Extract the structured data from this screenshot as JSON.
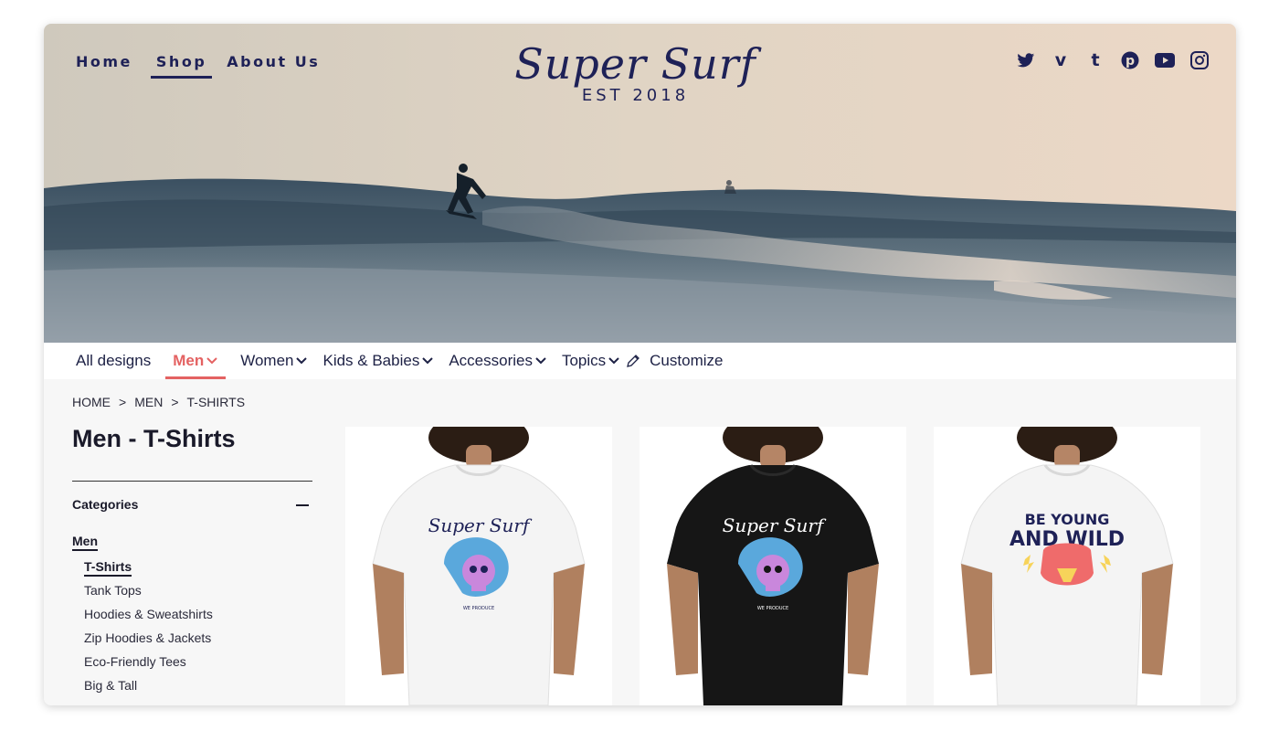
{
  "header": {
    "nav": [
      {
        "label": "Home",
        "active": false
      },
      {
        "label": "Shop",
        "active": true
      },
      {
        "label": "About Us",
        "active": false
      }
    ],
    "logo": {
      "name": "Super Surf",
      "tagline": "EST 2018"
    },
    "social_icons": [
      "twitter-icon",
      "vimeo-icon",
      "tumblr-icon",
      "pinterest-icon",
      "youtube-icon",
      "instagram-icon"
    ],
    "brand_color": "#1e2157"
  },
  "category_nav": {
    "items": [
      {
        "label": "All designs",
        "dropdown": false,
        "active": false
      },
      {
        "label": "Men",
        "dropdown": true,
        "active": true
      },
      {
        "label": "Women",
        "dropdown": true,
        "active": false
      },
      {
        "label": "Kids & Babies",
        "dropdown": true,
        "active": false
      },
      {
        "label": "Accessories",
        "dropdown": true,
        "active": false
      },
      {
        "label": "Topics",
        "dropdown": true,
        "active": false
      }
    ],
    "customize": {
      "label": "Customize",
      "icon": "pencil-icon"
    },
    "accent_color": "#e46262"
  },
  "breadcrumb": [
    "HOME",
    ">",
    "MEN",
    ">",
    "T-SHIRTS"
  ],
  "page_title": "Men - T-Shirts",
  "sidebar": {
    "heading": "Categories",
    "parent": "Men",
    "items": [
      {
        "label": "T-Shirts",
        "active": true
      },
      {
        "label": "Tank Tops",
        "active": false
      },
      {
        "label": "Hoodies & Sweatshirts",
        "active": false
      },
      {
        "label": "Zip Hoodies & Jackets",
        "active": false
      },
      {
        "label": "Eco-Friendly Tees",
        "active": false
      },
      {
        "label": "Big & Tall",
        "active": false
      }
    ]
  },
  "products": [
    {
      "shirt_color": "#f4f4f4",
      "print_text": "Super Surf",
      "print_color": "#1e2157",
      "graphic": "skull-wave"
    },
    {
      "shirt_color": "#161616",
      "print_text": "Super Surf",
      "print_color": "#ffffff",
      "graphic": "skull-wave"
    },
    {
      "shirt_color": "#f4f4f4",
      "print_text": "BE YOUNG AND WILD",
      "print_color": "#1e2157",
      "graphic": "bear"
    }
  ]
}
